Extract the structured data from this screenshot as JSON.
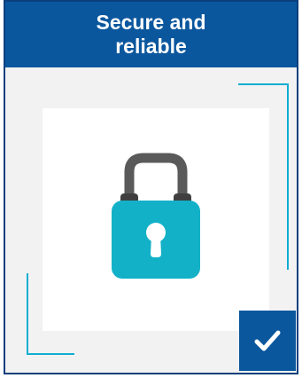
{
  "header": {
    "title": "Secure and reliable"
  },
  "icons": {
    "lock": "padlock-icon",
    "check": "checkmark-icon"
  },
  "colors": {
    "header_bg": "#0b579e",
    "accent_teal": "#10aed0",
    "lock_body": "#12b1c7",
    "lock_shackle": "#555555",
    "panel_bg": "#f2f2f2"
  }
}
